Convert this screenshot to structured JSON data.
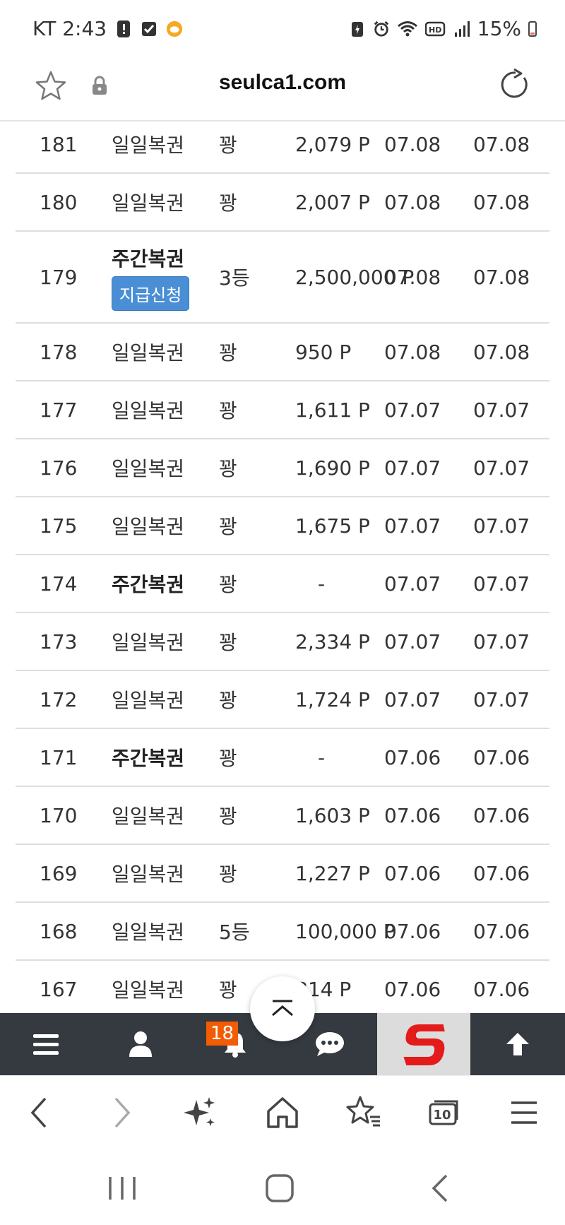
{
  "status_bar": {
    "carrier_time": "KT 2:43",
    "battery": "15%"
  },
  "address_bar": {
    "url": "seulca1.com"
  },
  "table": {
    "claim_label": "지급신청",
    "rows": [
      {
        "no": "181",
        "type": "일일복권",
        "bold": false,
        "claim": false,
        "rank": "꽝",
        "prize": "2,079 P",
        "date1": "07.08",
        "date2": "07.08"
      },
      {
        "no": "180",
        "type": "일일복권",
        "bold": false,
        "claim": false,
        "rank": "꽝",
        "prize": "2,007 P",
        "date1": "07.08",
        "date2": "07.08"
      },
      {
        "no": "179",
        "type": "주간복권",
        "bold": true,
        "claim": true,
        "rank": "3등",
        "prize": "2,500,000 P",
        "date1": "07.08",
        "date2": "07.08"
      },
      {
        "no": "178",
        "type": "일일복권",
        "bold": false,
        "claim": false,
        "rank": "꽝",
        "prize": "950 P",
        "date1": "07.08",
        "date2": "07.08"
      },
      {
        "no": "177",
        "type": "일일복권",
        "bold": false,
        "claim": false,
        "rank": "꽝",
        "prize": "1,611 P",
        "date1": "07.07",
        "date2": "07.07"
      },
      {
        "no": "176",
        "type": "일일복권",
        "bold": false,
        "claim": false,
        "rank": "꽝",
        "prize": "1,690 P",
        "date1": "07.07",
        "date2": "07.07"
      },
      {
        "no": "175",
        "type": "일일복권",
        "bold": false,
        "claim": false,
        "rank": "꽝",
        "prize": "1,675 P",
        "date1": "07.07",
        "date2": "07.07"
      },
      {
        "no": "174",
        "type": "주간복권",
        "bold": true,
        "claim": false,
        "rank": "꽝",
        "prize": "-",
        "date1": "07.07",
        "date2": "07.07"
      },
      {
        "no": "173",
        "type": "일일복권",
        "bold": false,
        "claim": false,
        "rank": "꽝",
        "prize": "2,334 P",
        "date1": "07.07",
        "date2": "07.07"
      },
      {
        "no": "172",
        "type": "일일복권",
        "bold": false,
        "claim": false,
        "rank": "꽝",
        "prize": "1,724 P",
        "date1": "07.07",
        "date2": "07.07"
      },
      {
        "no": "171",
        "type": "주간복권",
        "bold": true,
        "claim": false,
        "rank": "꽝",
        "prize": "-",
        "date1": "07.06",
        "date2": "07.06"
      },
      {
        "no": "170",
        "type": "일일복권",
        "bold": false,
        "claim": false,
        "rank": "꽝",
        "prize": "1,603 P",
        "date1": "07.06",
        "date2": "07.06"
      },
      {
        "no": "169",
        "type": "일일복권",
        "bold": false,
        "claim": false,
        "rank": "꽝",
        "prize": "1,227 P",
        "date1": "07.06",
        "date2": "07.06"
      },
      {
        "no": "168",
        "type": "일일복권",
        "bold": false,
        "claim": false,
        "rank": "5등",
        "prize": "100,000 P",
        "date1": "07.06",
        "date2": "07.06"
      },
      {
        "no": "167",
        "type": "일일복권",
        "bold": false,
        "claim": false,
        "rank": "꽝",
        "prize": "814 P",
        "date1": "07.06",
        "date2": "07.06"
      }
    ]
  },
  "site_nav": {
    "notification_count": "18",
    "icons": [
      "menu-icon",
      "user-icon",
      "bell-icon",
      "chat-icon",
      "site-logo",
      "arrow-up-icon"
    ]
  },
  "browser_toolbar": {
    "tab_count": "10"
  },
  "colors": {
    "nav_bg": "#343a40",
    "claim_button": "#4a8fd6",
    "badge": "#f25c05",
    "logo_red": "#e31b1b"
  }
}
